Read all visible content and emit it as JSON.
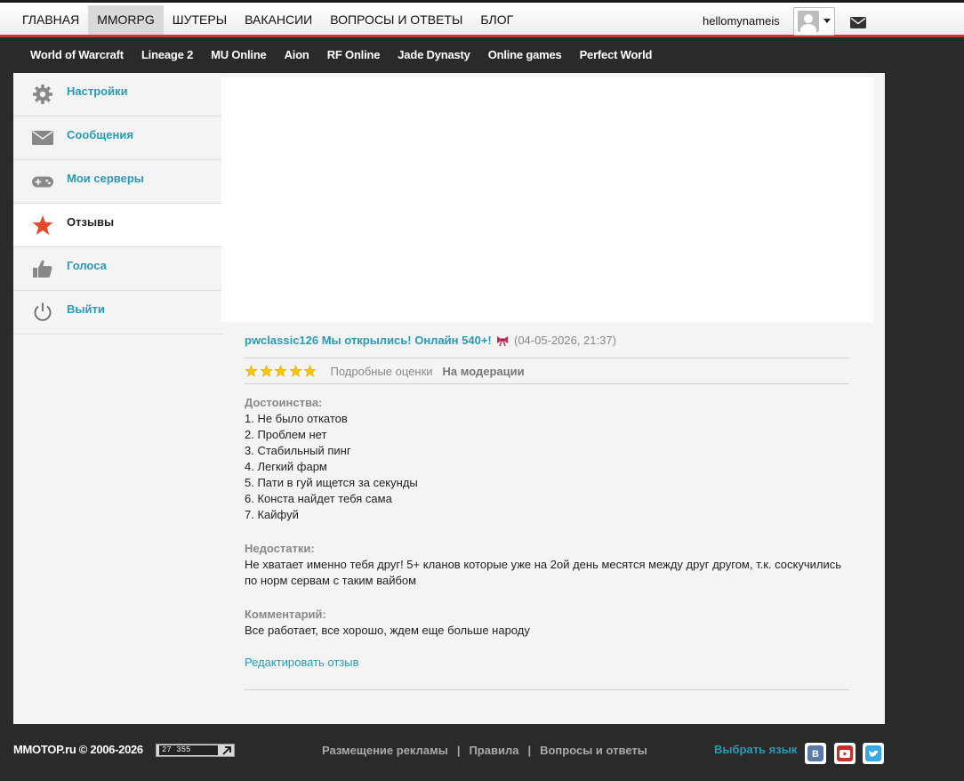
{
  "topnav": {
    "items": [
      {
        "label": "ГЛАВНАЯ"
      },
      {
        "label": "MMORPG"
      },
      {
        "label": "ШУТЕРЫ"
      },
      {
        "label": "ВАКАНСИИ"
      },
      {
        "label": "ВОПРОСЫ И ОТВЕТЫ"
      },
      {
        "label": "БЛОГ"
      }
    ],
    "active": "MMORPG",
    "username": "hellomynameis"
  },
  "gamenav": {
    "items": [
      {
        "label": "World of Warcraft"
      },
      {
        "label": "Lineage 2"
      },
      {
        "label": "MU Online"
      },
      {
        "label": "Aion"
      },
      {
        "label": "RF Online"
      },
      {
        "label": "Jade Dynasty"
      },
      {
        "label": "Online games"
      },
      {
        "label": "Perfect World"
      }
    ]
  },
  "sidebar": {
    "items": [
      {
        "label": "Настройки",
        "icon": "gear-icon"
      },
      {
        "label": "Сообщения",
        "icon": "envelope-icon"
      },
      {
        "label": "Мои серверы",
        "icon": "gamepad-icon"
      },
      {
        "label": "Отзывы",
        "icon": "star-icon"
      },
      {
        "label": "Голоса",
        "icon": "thumbs-up-icon"
      },
      {
        "label": "Выйти",
        "icon": "power-icon"
      }
    ],
    "active": "Отзывы"
  },
  "review": {
    "server_title": "pwclassic126 Мы открылись! Онлайн 540+!",
    "date": "(04-05-2026, 21:37)",
    "rating": 5,
    "detail_label": "Подробные оценки",
    "status": "На модерации",
    "pros_title": "Достоинства:",
    "pros": [
      "1. Не было откатов",
      "2. Проблем нет",
      "3. Стабильный пинг",
      "4. Легкий фарм",
      "5. Пати в гуй ищется за секунды",
      "6. Конста найдет тебя сама",
      "7. Кайфуй"
    ],
    "cons_title": "Недостатки:",
    "cons": [
      "Не хватает именно тебя друг! 5+ кланов которые уже на 2ой день месятся между друг другом, т.к. соскучились",
      "по норм сервам с таким вайбом"
    ],
    "comment_title": "Комментарий:",
    "comment": "Все работает, все хорошо, ждем еще больше народу",
    "edit_label": "Редактировать отзыв"
  },
  "footer": {
    "copyright": "MMOTOP.ru © 2006-2026",
    "counter": "27 355",
    "links": [
      {
        "label": "Размещение рекламы"
      },
      {
        "label": "Правила"
      },
      {
        "label": "Вопросы и ответы"
      }
    ],
    "lang_label": "Выбрать язык",
    "socials": [
      {
        "icon": "vk-icon",
        "color": "#5b7aa8"
      },
      {
        "icon": "youtube-icon",
        "color": "#c4302b"
      },
      {
        "icon": "twitter-icon",
        "color": "#38a8e0"
      }
    ]
  },
  "colors": {
    "accent": "#2a9ab5",
    "header_stripe": "#cc3333",
    "dark_bg": "#2a2a2a",
    "star": "#f7c600"
  }
}
